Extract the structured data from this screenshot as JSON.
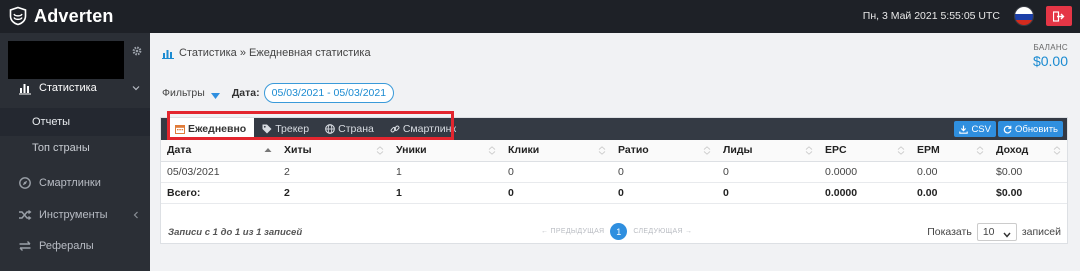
{
  "app": {
    "brand": "Adverten",
    "datetime": "Пн, 3 Май 2021 5:55:05 UTC"
  },
  "sidebar": {
    "items": [
      {
        "label": "Статистика",
        "icon": "bar-chart-icon"
      },
      {
        "label": "Смартлинки",
        "icon": "compass-icon"
      },
      {
        "label": "Инструменты",
        "icon": "shuffle-icon"
      },
      {
        "label": "Рефералы",
        "icon": "exchange-icon"
      }
    ],
    "subitems": [
      {
        "label": "Отчеты"
      },
      {
        "label": "Топ страны"
      }
    ]
  },
  "breadcrumb": {
    "section": "Статистика",
    "separator": " » ",
    "page": "Ежедневная статистика"
  },
  "balance": {
    "label": "БАЛАНС",
    "value": "$0.00"
  },
  "filters": {
    "toggle_label": "Фильтры",
    "date_label": "Дата:",
    "date_range": "05/03/2021 - 05/03/2021"
  },
  "tabs": [
    {
      "label": "Ежедневно",
      "icon": "calendar-icon",
      "active": true
    },
    {
      "label": "Трекер",
      "icon": "tag-icon",
      "active": false
    },
    {
      "label": "Страна",
      "icon": "globe-icon",
      "active": false
    },
    {
      "label": "Смартлинк",
      "icon": "link-icon",
      "active": false
    }
  ],
  "buttons": {
    "csv": "CSV",
    "refresh": "Обновить"
  },
  "table": {
    "columns": [
      "Дата",
      "Хиты",
      "Уники",
      "Клики",
      "Ратио",
      "Лиды",
      "EPC",
      "EPM",
      "Доход"
    ],
    "rows": [
      [
        "05/03/2021",
        "2",
        "1",
        "0",
        "0",
        "0",
        "0.0000",
        "0.00",
        "$0.00"
      ]
    ],
    "total": [
      "Всего:",
      "2",
      "1",
      "0",
      "0",
      "0",
      "0.0000",
      "0.00",
      "$0.00"
    ]
  },
  "footer": {
    "records_info": "Записи с 1 до 1 из 1 записей",
    "prev": "← ПРЕДЫДУЩАЯ",
    "page": "1",
    "next": "СЛЕДУЮЩАЯ →",
    "show_label": "Показать",
    "per_page": "10",
    "records_label": "записей"
  },
  "colors": {
    "topbar": "#1e2127",
    "sidebar": "#2b2f36",
    "accent": "#2f8fdf",
    "logout": "#e53646",
    "highlight": "#e3262f"
  }
}
